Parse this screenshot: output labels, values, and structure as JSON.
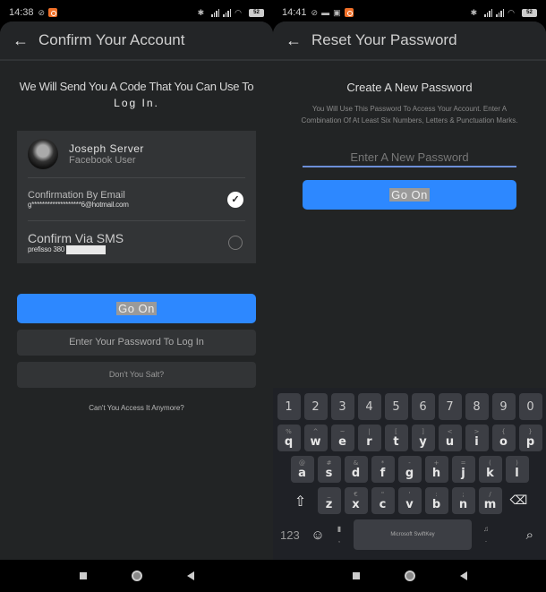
{
  "left": {
    "status": {
      "time": "14:38",
      "battery": "52"
    },
    "appbar": {
      "title": "Confirm Your Account"
    },
    "intro": {
      "line1": "We Will Send You A Code That You Can Use To",
      "line2": "Log In."
    },
    "account": {
      "name": "Joseph Server",
      "subtitle": "Facebook User"
    },
    "options": [
      {
        "title": "Confirmation By Email",
        "detail": "g*******************6@hotmail.com",
        "selected": true
      },
      {
        "title": "Confirm Via SMS",
        "detail": "prefisso 380",
        "selected": false
      }
    ],
    "buttons": {
      "go_on": "Go On",
      "password_login": "Enter Your Password To Log In",
      "dont_you_salt": "Don't You Salt?"
    },
    "link": "Can't You Access It Anymore?"
  },
  "right": {
    "status": {
      "time": "14:41",
      "battery": "52"
    },
    "appbar": {
      "title": "Reset Your Password"
    },
    "heading": "Create A New Password",
    "description": "You Will Use This Password To Access Your Account. Enter A Combination Of At Least Six Numbers, Letters & Punctuation Marks.",
    "password_input": {
      "placeholder": "Enter A New Password",
      "value": ""
    },
    "go_on": "Go On",
    "keyboard": {
      "number_row": [
        "1",
        "2",
        "3",
        "4",
        "5",
        "6",
        "7",
        "8",
        "9",
        "0"
      ],
      "row1": [
        {
          "k": "q",
          "a": "%"
        },
        {
          "k": "w",
          "a": "^"
        },
        {
          "k": "e",
          "a": "~"
        },
        {
          "k": "r",
          "a": "|"
        },
        {
          "k": "t",
          "a": "["
        },
        {
          "k": "y",
          "a": "]"
        },
        {
          "k": "u",
          "a": "<"
        },
        {
          "k": "i",
          "a": ">"
        },
        {
          "k": "o",
          "a": "{"
        },
        {
          "k": "p",
          "a": "}"
        }
      ],
      "row2": [
        {
          "k": "a",
          "a": "@"
        },
        {
          "k": "s",
          "a": "#"
        },
        {
          "k": "d",
          "a": "&"
        },
        {
          "k": "f",
          "a": "*"
        },
        {
          "k": "g",
          "a": "-"
        },
        {
          "k": "h",
          "a": "+"
        },
        {
          "k": "j",
          "a": "="
        },
        {
          "k": "k",
          "a": "("
        },
        {
          "k": "l",
          "a": ")"
        }
      ],
      "row3": [
        {
          "k": "z",
          "a": "_"
        },
        {
          "k": "x",
          "a": "€"
        },
        {
          "k": "c",
          "a": "\""
        },
        {
          "k": "v",
          "a": "'"
        },
        {
          "k": "b",
          "a": ":"
        },
        {
          "k": "n",
          "a": ";"
        },
        {
          "k": "m",
          "a": "/"
        }
      ],
      "symbols_label": "123",
      "space_label": "Microsoft SwiftKey"
    }
  }
}
